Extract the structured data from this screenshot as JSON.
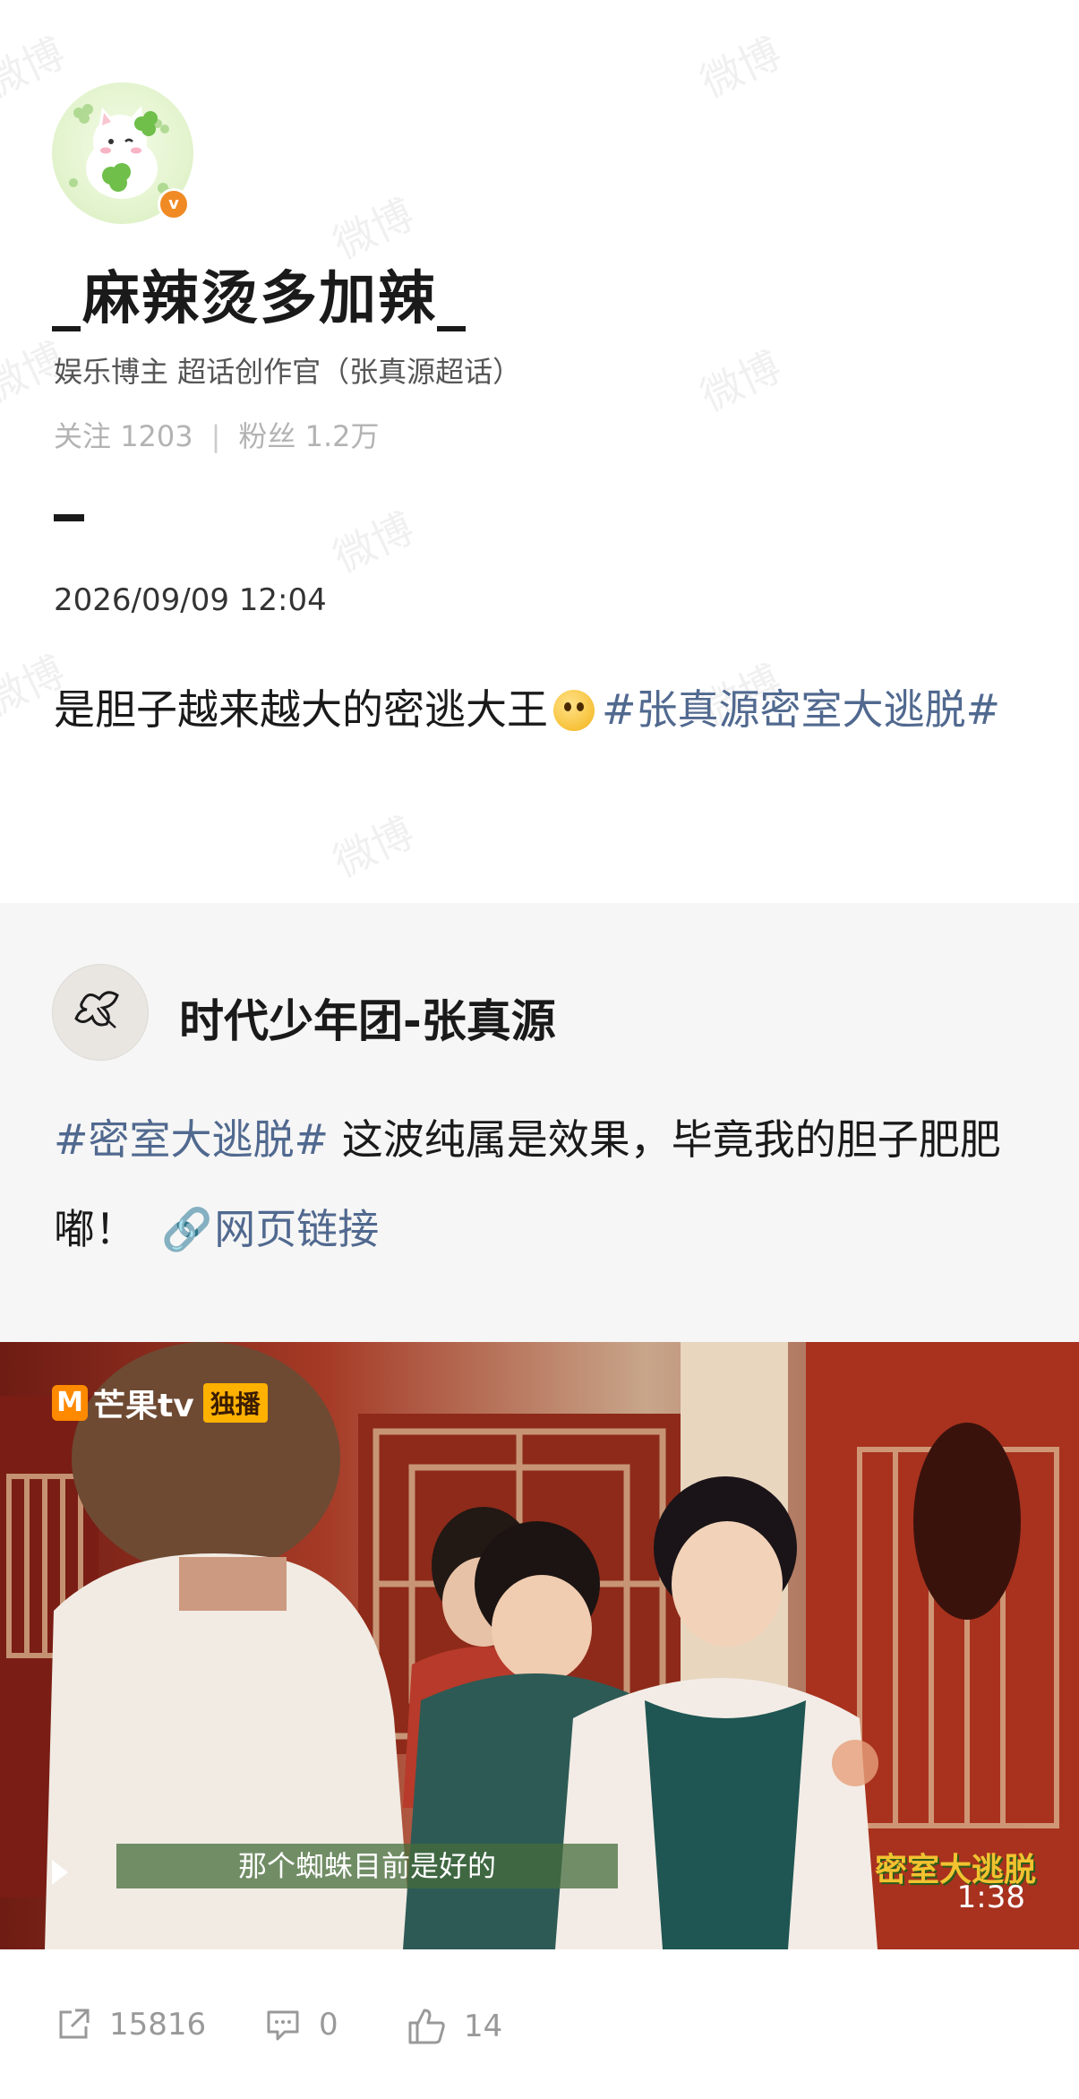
{
  "profile": {
    "username": "_麻辣烫多加辣_",
    "description": "娱乐博主 超话创作官（张真源超话）",
    "following_label": "关注",
    "following_count": "1203",
    "followers_label": "粉丝",
    "followers_count": "1.2万",
    "verified_icon": "v"
  },
  "post": {
    "timestamp": "2026/09/09 12:04",
    "text": "是胆子越来越大的密逃大王",
    "emoji": "pray-emoji",
    "hashtag": "#张真源密室大逃脱#"
  },
  "repost": {
    "author": "时代少年团-张真源",
    "hashtag": "#密室大逃脱#",
    "text": " 这波纯属是效果，毕竟我的胆子肥肥嘟！",
    "link_icon": "🔗",
    "link_label": "网页链接"
  },
  "video": {
    "channel": "芒果tv",
    "channel_badge": "独播",
    "channel_logo_letter": "M",
    "subtitle": "那个蜘蛛目前是好的",
    "show_logo": "密室大逃脱",
    "duration": "1:38"
  },
  "actions": {
    "share_count": "15816",
    "comment_count": "0",
    "like_count": "14"
  },
  "watermark": "微博",
  "colors": {
    "link": "#51698f",
    "badge": "#f08a24",
    "card_bg": "#f6f6f6"
  }
}
